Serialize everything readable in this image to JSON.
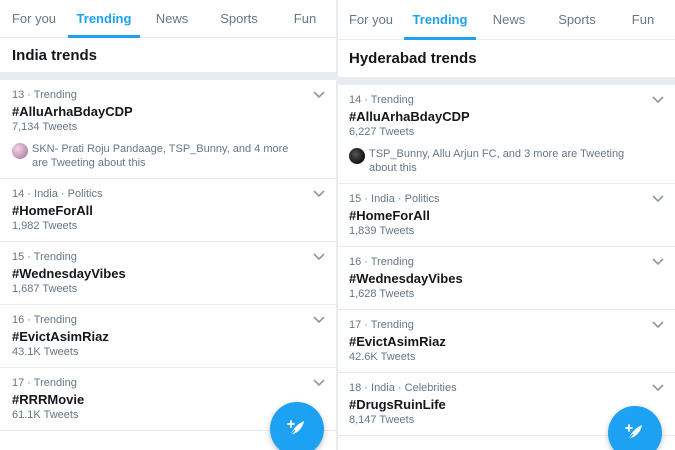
{
  "colors": {
    "accent": "#1da1f2",
    "secondary_text": "#657786",
    "primary_text": "#14171a",
    "divider": "#e6ecf0"
  },
  "left": {
    "tabs": [
      {
        "label": "For you"
      },
      {
        "label": "Trending",
        "active": true
      },
      {
        "label": "News"
      },
      {
        "label": "Sports"
      },
      {
        "label": "Fun"
      }
    ],
    "section_title": "India trends",
    "trends": [
      {
        "meta": "13 · Trending",
        "name": "#AlluArhaBdayCDP",
        "count": "7,134 Tweets",
        "context": "SKN- Prati Roju Pandaage, TSP_Bunny, and 4 more are Tweeting about this"
      },
      {
        "meta": "14 · India · Politics",
        "name": "#HomeForAll",
        "count": "1,982 Tweets"
      },
      {
        "meta": "15 · Trending",
        "name": "#WednesdayVibes",
        "count": "1,687 Tweets"
      },
      {
        "meta": "16 · Trending",
        "name": "#EvictAsimRiaz",
        "count": "43.1K Tweets"
      },
      {
        "meta": "17 · Trending",
        "name": "#RRRMovie",
        "count": "61.1K Tweets"
      }
    ],
    "fab_icon": "compose-tweet-icon"
  },
  "right": {
    "tabs": [
      {
        "label": "For you"
      },
      {
        "label": "Trending",
        "active": true
      },
      {
        "label": "News"
      },
      {
        "label": "Sports"
      },
      {
        "label": "Fun"
      }
    ],
    "section_title": "Hyderabad trends",
    "trends": [
      {
        "meta": "14 · Trending",
        "name": "#AlluArhaBdayCDP",
        "count": "6,227 Tweets",
        "context": "TSP_Bunny, Allu Arjun FC, and 3 more are Tweeting about this"
      },
      {
        "meta": "15 · India · Politics",
        "name": "#HomeForAll",
        "count": "1,839 Tweets"
      },
      {
        "meta": "16 · Trending",
        "name": "#WednesdayVibes",
        "count": "1,628 Tweets"
      },
      {
        "meta": "17 · Trending",
        "name": "#EvictAsimRiaz",
        "count": "42.6K Tweets"
      },
      {
        "meta": "18 · India · Celebrities",
        "name": "#DrugsRuinLife",
        "count": "8,147 Tweets"
      }
    ],
    "fab_icon": "compose-tweet-icon"
  }
}
